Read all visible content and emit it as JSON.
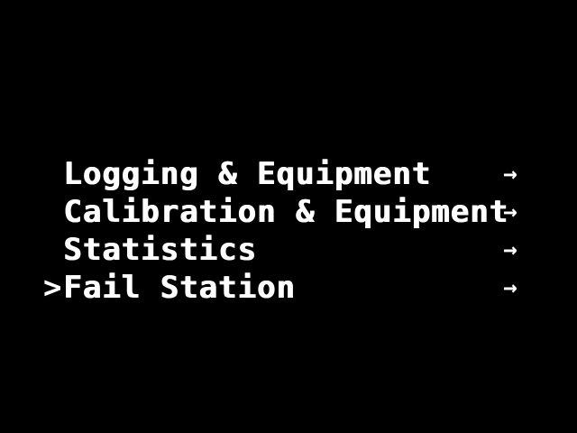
{
  "screen": {
    "background": "#000000",
    "foreground": "#ffffff"
  },
  "menu": {
    "selected_index": 3,
    "cursor_glyph": ">",
    "items": [
      {
        "label": "Logging & Equipment",
        "arrow": "→",
        "arrow_icon": "right-arrow-icon"
      },
      {
        "label": "Calibration & Equipment",
        "arrow": "→",
        "arrow_icon": "right-arrow-icon"
      },
      {
        "label": "Statistics",
        "arrow": "→",
        "arrow_icon": "right-arrow-icon"
      },
      {
        "label": "Fail Station",
        "arrow": "→",
        "arrow_icon": "right-arrow-icon"
      }
    ]
  }
}
